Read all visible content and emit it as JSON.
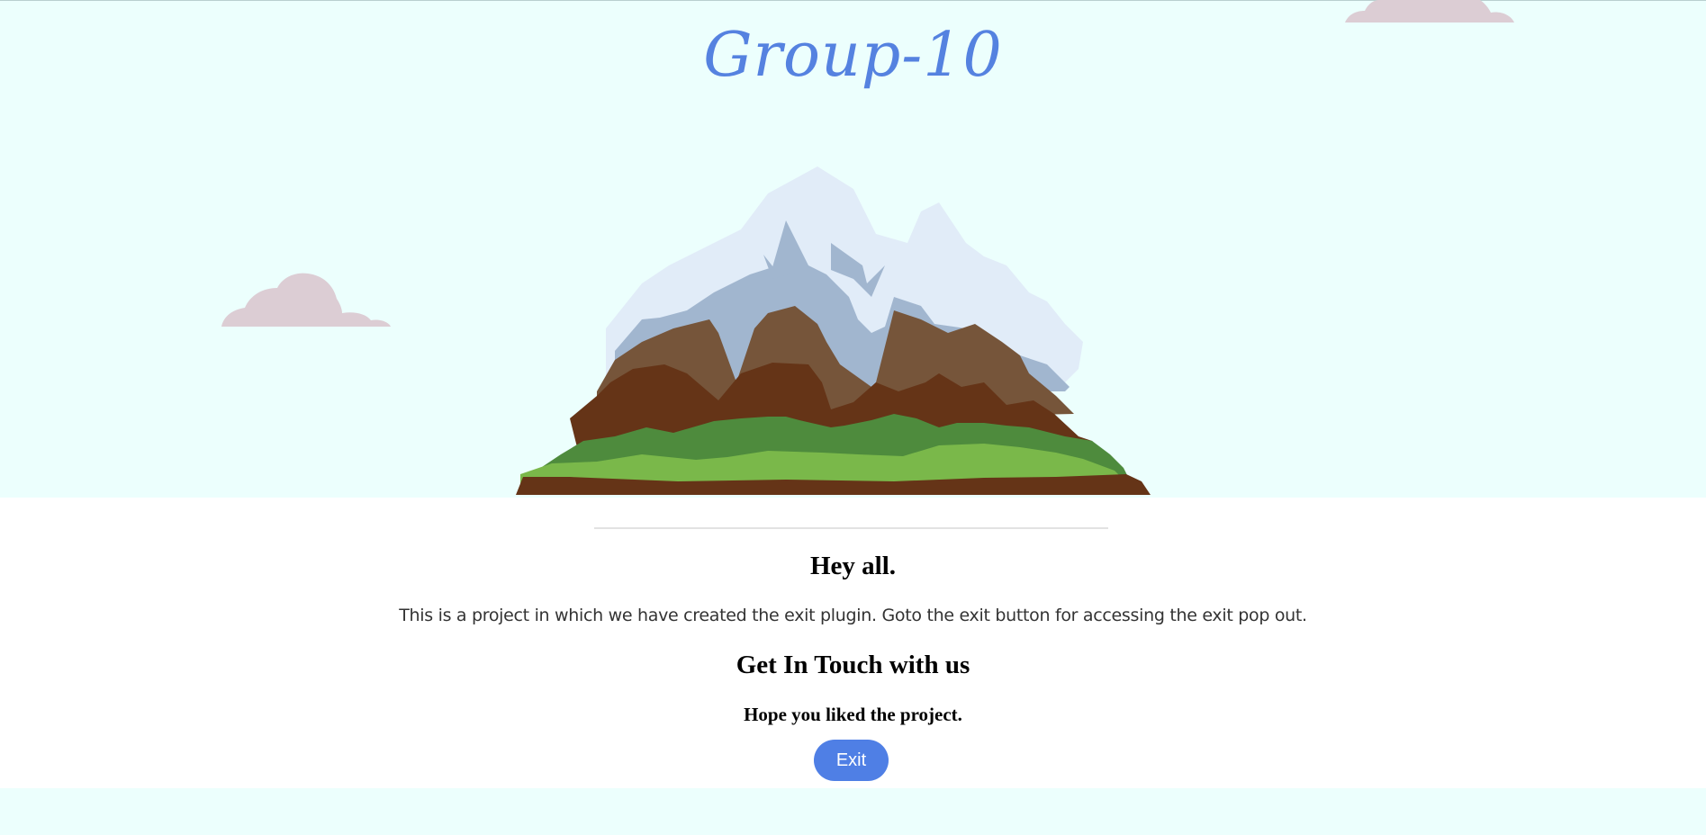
{
  "header": {
    "title": "Group-10"
  },
  "main": {
    "greeting": "Hey all.",
    "description": "This is a project in which we have created the exit plugin. Goto the exit button for accessing the exit pop out.",
    "contact_heading": "Get In Touch with us",
    "closing_note": "Hope you liked the project.",
    "exit_label": "Exit"
  },
  "colors": {
    "background": "#ecfffd",
    "title": "#5582e0",
    "button": "#4f7fe5",
    "cloud": "#dccdd4"
  },
  "icons": {
    "hero": "mountain-illustration",
    "decor": "cloud-icon"
  }
}
